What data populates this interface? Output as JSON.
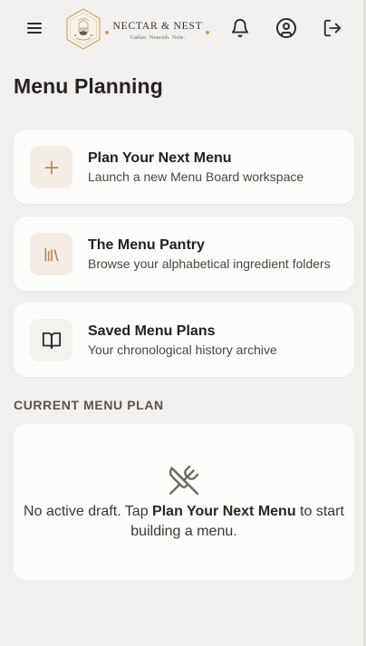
{
  "header": {
    "brand_name": "NECTAR & NEST",
    "brand_tagline": "Gather. Nourish. Note."
  },
  "page": {
    "title": "Menu Planning"
  },
  "cards": [
    {
      "title": "Plan Your Next Menu",
      "subtitle": "Launch a new Menu Board workspace",
      "icon": "plus-icon"
    },
    {
      "title": "The Menu Pantry",
      "subtitle": "Browse your alphabetical ingredient folders",
      "icon": "library-icon"
    },
    {
      "title": "Saved Menu Plans",
      "subtitle": "Your chronological history archive",
      "icon": "book-open-icon"
    }
  ],
  "current_plan": {
    "section_label": "CURRENT MENU PLAN",
    "empty_prefix": "No active draft. Tap ",
    "empty_link": "Plan Your Next Menu",
    "empty_suffix": " to start building a menu.",
    "icon": "utensils-crossed-off-icon"
  },
  "colors": {
    "accent": "#b08a5a",
    "background": "#f1f0ee",
    "card": "#fcfcfb",
    "icon_tile": "#f4ede6"
  }
}
